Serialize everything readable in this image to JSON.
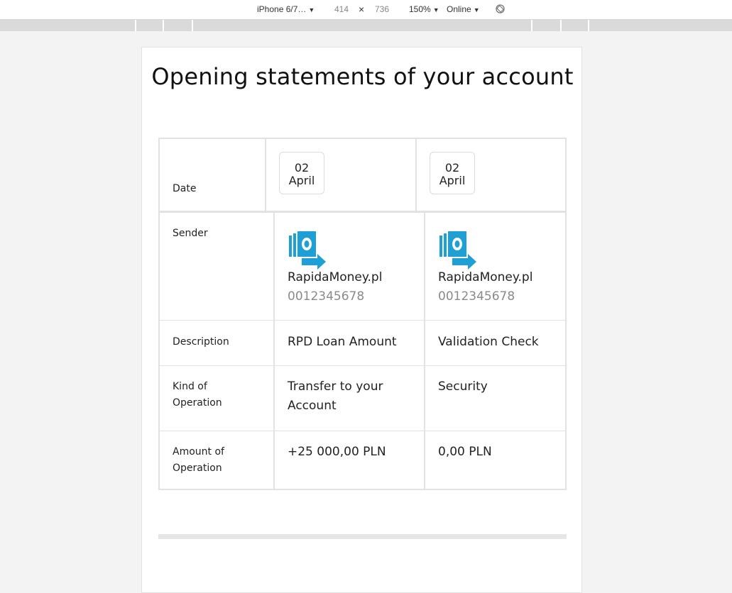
{
  "devtools": {
    "device": "iPhone 6/7…",
    "width": "414",
    "times": "×",
    "height": "736",
    "zoom": "150%",
    "network": "Online",
    "caret": "▼"
  },
  "page": {
    "title": "Opening statements of your account"
  },
  "table": {
    "labels": {
      "date": "Date",
      "sender": "Sender",
      "description": "Description",
      "kind": "Kind of Operation",
      "amount": "Amount of Operation"
    },
    "columns": [
      {
        "date_day": "02",
        "date_month": "April",
        "sender_name": "RapidaMoney.pl",
        "sender_account": "0012345678",
        "description": "RPD Loan Amount",
        "kind": "Transfer to your Account",
        "amount": "+25 000,00 PLN"
      },
      {
        "date_day": "02",
        "date_month": "April",
        "sender_name": "RapidaMoney.pl",
        "sender_account": "0012345678",
        "description": "Validation Check",
        "kind": "Security",
        "amount": "0,00 PLN"
      }
    ]
  },
  "icons": {
    "sender_logo": "money-transfer-icon",
    "rotate": "rotate-icon"
  },
  "colors": {
    "logo_blue": "#1ea0d6",
    "border": "#dfe3e6",
    "muted_text": "#8a8a8a"
  }
}
